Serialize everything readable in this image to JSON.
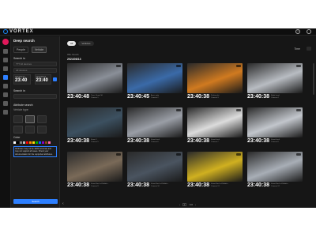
{
  "app": {
    "brand": "VORTEX"
  },
  "panel": {
    "title": "Deep search",
    "tabs": [
      "People",
      "Vehicle"
    ],
    "search_in_label": "Search in",
    "field1": "??? All devices",
    "field2": "All devices",
    "from_date": "2024/06/13",
    "from_time": "23:40",
    "to_date": "2024/06/13",
    "to_time": "23:40",
    "search_in_label2": "Search in",
    "attr_label": "Attribute search",
    "vehicle_type_label": "Vehicle type",
    "color_label": "Color",
    "warning": "Attributes may not be 100% accurate and may not support all cases. Check your documentation for the supported attributes.",
    "search_button": "Search"
  },
  "main": {
    "pills": [
      "All",
      "Vehicles"
    ],
    "sort_label": "Time",
    "results": "999+ Results",
    "date_heading": "2024/06/13",
    "pager_page": "1",
    "pager_total": "/ 20"
  },
  "cards": [
    {
      "time": "23:40:48",
      "l1": "Time: Street 56",
      "l2": "Camera 1",
      "color": "#8a8f98"
    },
    {
      "time": "23:40:45",
      "l1": "Area: gate",
      "l2": "Camera 2",
      "color": "#3a6aa8"
    },
    {
      "time": "23:40:38",
      "l1": "Parking lot",
      "l2": "Camera 3",
      "color": "#d07a20"
    },
    {
      "time": "23:40:38",
      "l1": "Right hand",
      "l2": "Camera 4",
      "color": "#b8bcc2"
    },
    {
      "time": "23:40:38",
      "l1": "Street 1",
      "l2": "Camera 5",
      "color": "#3c5060"
    },
    {
      "time": "23:40:38",
      "l1": "Street back",
      "l2": "Camera 6",
      "color": "#9a9ea6"
    },
    {
      "time": "23:40:38",
      "l1": "Street back",
      "l2": "Camera 7",
      "color": "#dcdcdc"
    },
    {
      "time": "23:40:38",
      "l1": "Street back",
      "l2": "Camera 8",
      "color": "#c2c6cc"
    },
    {
      "time": "23:40:38",
      "l1": "Street Back of Buildin...",
      "l2": "Camera 9",
      "color": "#7a6a58"
    },
    {
      "time": "23:40:38",
      "l1": "Street Back of Buildin...",
      "l2": "Camera 10",
      "color": "#4a5460"
    },
    {
      "time": "23:40:38",
      "l1": "Street Back of Buildin...",
      "l2": "Camera 11",
      "color": "#d0b020"
    },
    {
      "time": "23:40:38",
      "l1": "Street Back of Buildin...",
      "l2": "Camera 12",
      "color": "#a8aeb6"
    }
  ],
  "swatches": [
    "#ffffff",
    "#000000",
    "#808080",
    "#c0c0c0",
    "#ff0000",
    "#ff8800",
    "#ffdd00",
    "#00aa00",
    "#0066ff",
    "#8800cc",
    "#8b4513",
    "#ff66aa"
  ],
  "vehicle_icons": [
    "sedan-icon",
    "suv-icon",
    "truck-icon",
    "bus-icon",
    "motorcycle-icon",
    "bicycle-icon",
    "van-icon"
  ]
}
